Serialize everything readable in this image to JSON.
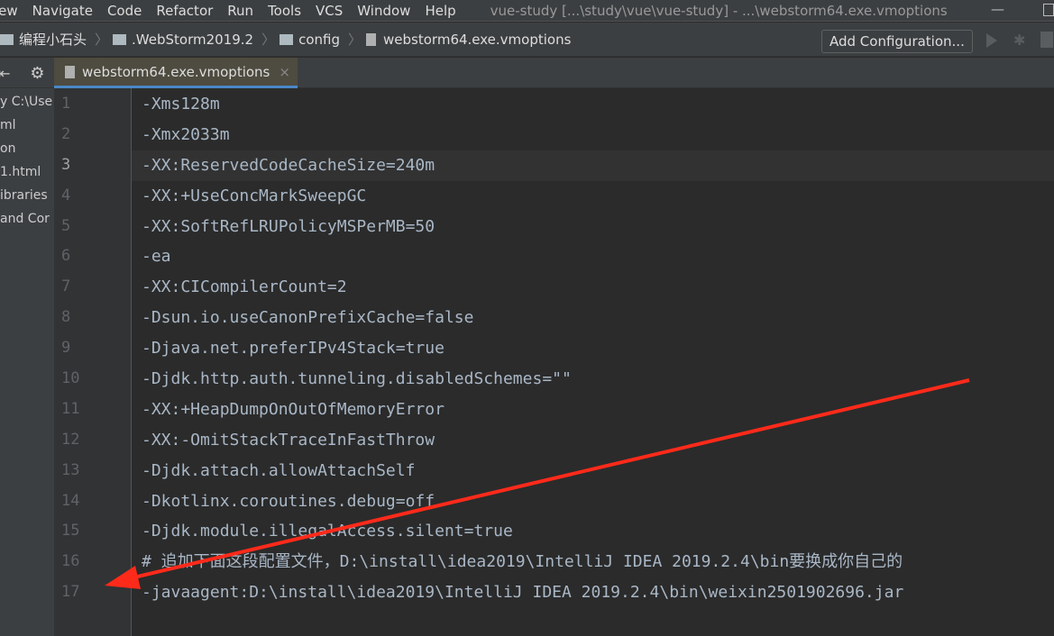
{
  "menu": [
    "iew",
    "Navigate",
    "Code",
    "Refactor",
    "Run",
    "Tools",
    "VCS",
    "Window",
    "Help"
  ],
  "window_title": "vue-study [...\\study\\vue\\vue-study] - ...\\webstorm64.exe.vmoptions",
  "breadcrumbs": [
    "编程小石头",
    ".WebStorm2019.2",
    "config",
    "webstorm64.exe.vmoptions"
  ],
  "add_configuration": "Add Configuration...",
  "tab": {
    "label": "webstorm64.exe.vmoptions",
    "close": "×"
  },
  "sidebar": [
    "y C:\\Use",
    "ml",
    "on",
    "1.html",
    "ibraries",
    " and Cor"
  ],
  "current_line": 3,
  "lines": [
    "-Xms128m",
    "-Xmx2033m",
    "-XX:ReservedCodeCacheSize=240m",
    "-XX:+UseConcMarkSweepGC",
    "-XX:SoftRefLRUPolicyMSPerMB=50",
    "-ea",
    "-XX:CICompilerCount=2",
    "-Dsun.io.useCanonPrefixCache=false",
    "-Djava.net.preferIPv4Stack=true",
    "-Djdk.http.auth.tunneling.disabledSchemes=\"\"",
    "-XX:+HeapDumpOnOutOfMemoryError",
    "-XX:-OmitStackTraceInFastThrow",
    "-Djdk.attach.allowAttachSelf",
    "-Dkotlinx.coroutines.debug=off",
    "-Djdk.module.illegalAccess.silent=true",
    "# 追加下面这段配置文件，D:\\install\\idea2019\\IntelliJ IDEA 2019.2.4\\bin要换成你自己的",
    "-javaagent:D:\\install\\idea2019\\IntelliJ IDEA 2019.2.4\\bin\\weixin2501902696.jar"
  ],
  "line_numbers": [
    "1",
    "2",
    "3",
    "4",
    "5",
    "6",
    "7",
    "8",
    "9",
    "10",
    "11",
    "12",
    "13",
    "14",
    "15",
    "16",
    "17"
  ],
  "arrow_color": "#ff2a1a"
}
